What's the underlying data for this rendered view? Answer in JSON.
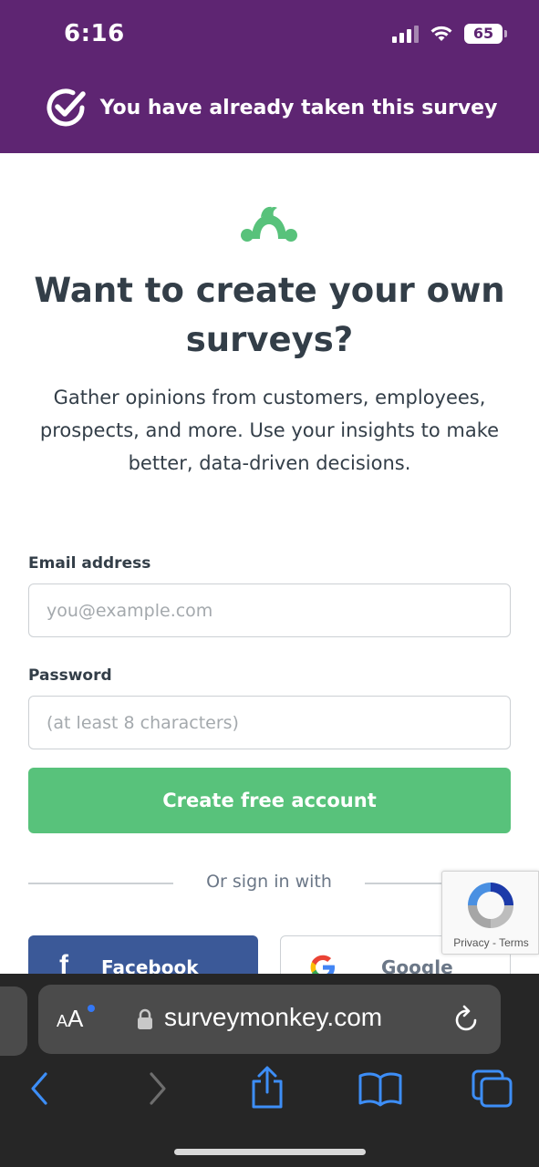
{
  "status_bar": {
    "time": "6:16",
    "battery": "65",
    "icons": [
      "cellular-signal-icon",
      "wifi-icon",
      "battery-icon"
    ]
  },
  "banner": {
    "text": "You have already taken this survey",
    "icon": "check-circle-icon"
  },
  "hero": {
    "logo": "surveymonkey-logo",
    "headline_line1": "Want to create your own",
    "headline_line2": "surveys?",
    "subtext_line1": "Gather opinions from customers, employees,",
    "subtext_line2": "prospects, and more. Use your insights to make",
    "subtext_line3": "better, data-driven decisions."
  },
  "form": {
    "email_label": "Email address",
    "email_placeholder": "you@example.com",
    "password_label": "Password",
    "password_placeholder": "(at least 8 characters)",
    "submit_label": "Create free account"
  },
  "social": {
    "divider_text": "Or sign in with",
    "facebook_label": "Facebook",
    "google_label": "Google"
  },
  "recaptcha": {
    "privacy": "Privacy",
    "separator": "-",
    "terms": "Terms"
  },
  "browser": {
    "text_size_label": "AA",
    "domain": "surveymonkey.com",
    "nav_icons": [
      "back-icon",
      "forward-icon",
      "share-icon",
      "bookmarks-icon",
      "tabs-icon"
    ]
  },
  "colors": {
    "banner_bg": "#5e2572",
    "cta_green": "#58c27b",
    "facebook_blue": "#3b5998",
    "text_dark": "#333e48"
  }
}
